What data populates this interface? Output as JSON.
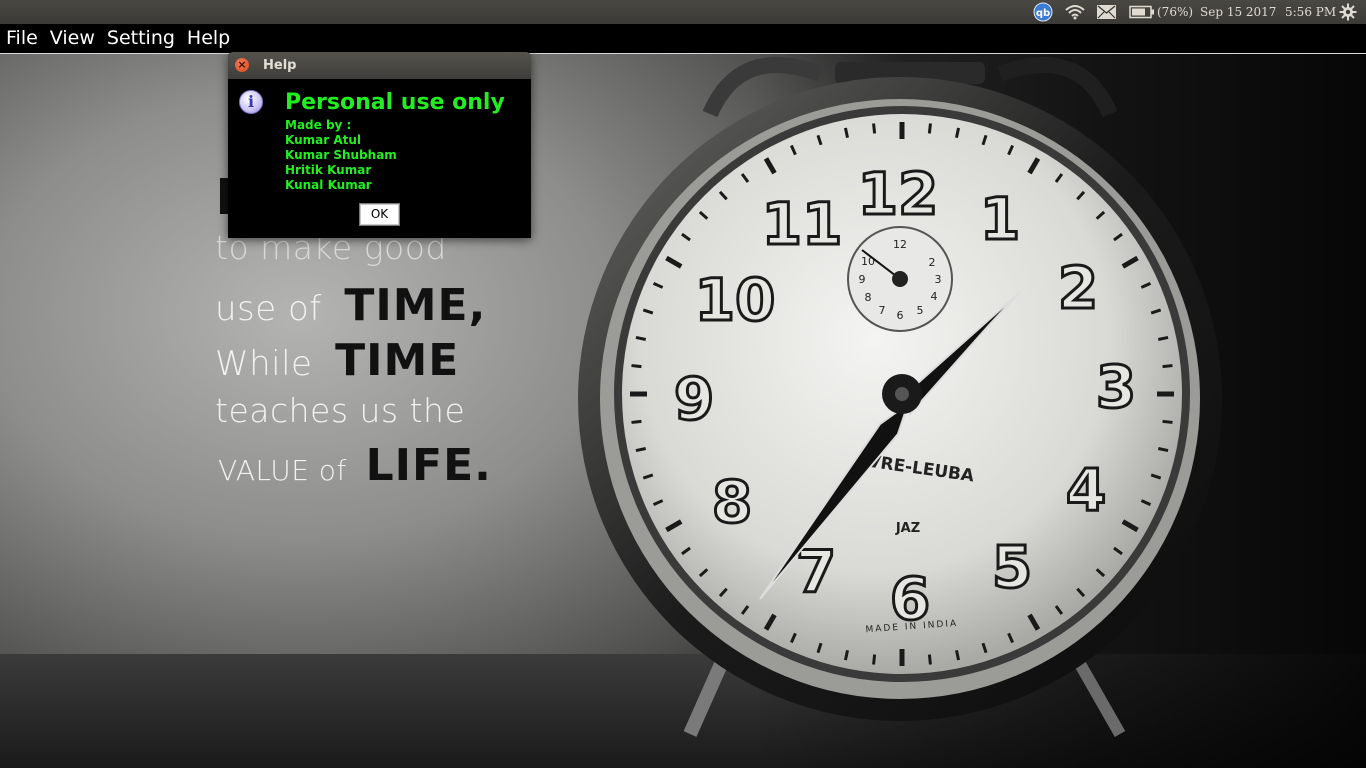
{
  "system_panel": {
    "battery_percent": "(76%)",
    "date": "Sep 15 2017",
    "time": "5:56 PM",
    "icons": [
      "qbittorrent-icon",
      "wifi-icon",
      "mail-icon",
      "battery-icon",
      "settings-gear-icon"
    ]
  },
  "menubar": {
    "items": [
      "File",
      "View",
      "Setting",
      "Help"
    ]
  },
  "wallpaper": {
    "quote_lines": [
      {
        "light": "to make good",
        "bold": ""
      },
      {
        "light": "use of",
        "bold": "TIME,"
      },
      {
        "light": "While",
        "bold": "TIME"
      },
      {
        "light": "teaches us the",
        "bold": ""
      },
      {
        "light": "VALUE of",
        "bold": "LIFE."
      }
    ],
    "clock": {
      "numerals": [
        "12",
        "1",
        "2",
        "3",
        "4",
        "5",
        "6",
        "7",
        "8",
        "9",
        "10",
        "11"
      ],
      "sub_dial_numerals": [
        "12",
        "2",
        "3",
        "4",
        "5",
        "6",
        "7",
        "8",
        "9",
        "10"
      ],
      "brand": "VRE-LEUBA",
      "model": "JAZ",
      "origin": "MADE IN INDIA"
    }
  },
  "dialog": {
    "title": "Help",
    "heading": "Personal use only",
    "credits_label": "Made by :",
    "authors": [
      "Kumar Atul",
      "Kumar Shubham",
      "Hritik Kumar",
      "Kunal Kumar"
    ],
    "ok_label": "OK",
    "text_color": "#22ee22",
    "info_glyph": "i",
    "close_glyph": "×"
  }
}
